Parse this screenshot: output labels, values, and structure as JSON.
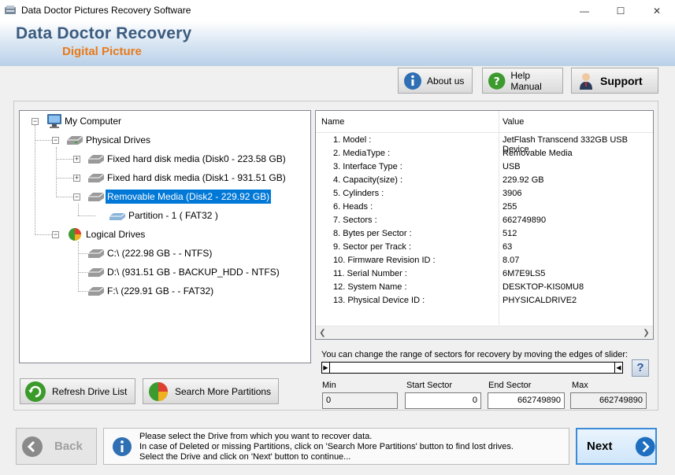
{
  "window": {
    "title": "Data Doctor Pictures Recovery Software",
    "minimize": "—",
    "maximize": "☐",
    "close": "✕"
  },
  "banner": {
    "title": "Data Doctor Recovery",
    "subtitle": "Digital Picture"
  },
  "toolbar": {
    "about_label": "About us",
    "help_label": "Help Manual",
    "support_label": "Support"
  },
  "tree": {
    "root": "My Computer",
    "physical": "Physical Drives",
    "disk0": "Fixed hard disk media (Disk0 - 223.58 GB)",
    "disk1": "Fixed hard disk media (Disk1 - 931.51 GB)",
    "disk2": "Removable Media (Disk2 - 229.92 GB)",
    "partition": "Partition - 1 ( FAT32 )",
    "logical": "Logical Drives",
    "drive_c": "C:\\ (222.98 GB -  - NTFS)",
    "drive_d": "D:\\ (931.51 GB - BACKUP_HDD - NTFS)",
    "drive_f": "F:\\ (229.91 GB -  - FAT32)"
  },
  "properties": {
    "col_name": "Name",
    "col_value": "Value",
    "rows": [
      {
        "name": "1. Model :",
        "value": "JetFlash Transcend 332GB USB Device"
      },
      {
        "name": "2. MediaType :",
        "value": "Removable Media"
      },
      {
        "name": "3. Interface Type :",
        "value": "USB"
      },
      {
        "name": "4. Capacity(size) :",
        "value": "229.92 GB"
      },
      {
        "name": "5. Cylinders :",
        "value": "3906"
      },
      {
        "name": "6. Heads :",
        "value": "255"
      },
      {
        "name": "7. Sectors :",
        "value": "662749890"
      },
      {
        "name": "8. Bytes per Sector :",
        "value": "512"
      },
      {
        "name": "9. Sector per Track :",
        "value": "63"
      },
      {
        "name": "10. Firmware Revision ID :",
        "value": "8.07"
      },
      {
        "name": "11. Serial Number :",
        "value": "6M7E9LS5"
      },
      {
        "name": "12. System Name :",
        "value": "DESKTOP-KIS0MU8"
      },
      {
        "name": "13. Physical Device ID :",
        "value": "PHYSICALDRIVE2"
      }
    ]
  },
  "range": {
    "instruction": "You can change the range of sectors for recovery by moving the edges of slider:",
    "help_glyph": "?",
    "min_label": "Min",
    "min_value": "0",
    "start_label": "Start Sector",
    "start_value": "0",
    "end_label": "End Sector",
    "end_value": "662749890",
    "max_label": "Max",
    "max_value": "662749890"
  },
  "actions": {
    "refresh_label": "Refresh Drive List",
    "search_label": "Search More Partitions"
  },
  "footer": {
    "back_label": "Back",
    "next_label": "Next",
    "info_line1": "Please select the Drive from which you want to recover data.",
    "info_line2": "In case of Deleted or missing Partitions, click on 'Search More Partitions' button to find lost drives.",
    "info_line3": "Select the Drive and click on 'Next' button to continue..."
  },
  "colors": {
    "banner_title": "#3b5b7f",
    "banner_sub": "#e77a1b",
    "selection": "#0078d7",
    "next_border": "#3c8bd9"
  }
}
